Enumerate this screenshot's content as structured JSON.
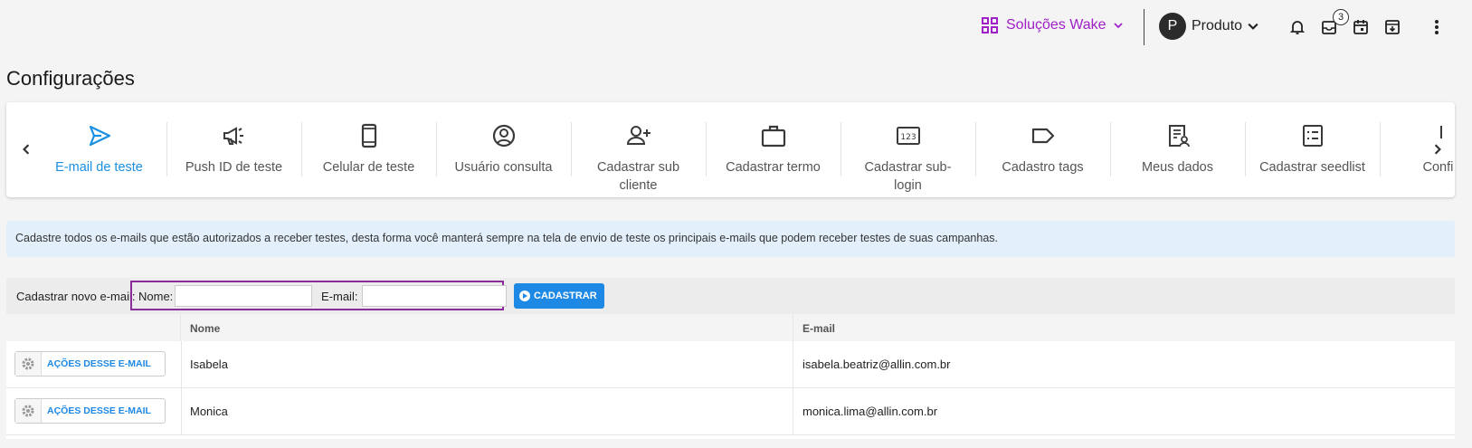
{
  "header": {
    "solutions_label": "Soluções Wake",
    "account_initial": "P",
    "account_label": "Produto",
    "notifications_badge": "3"
  },
  "page_title": "Configurações",
  "tabs": [
    {
      "label": "E-mail de teste",
      "icon": "send-icon",
      "active": true
    },
    {
      "label": "Push ID de teste",
      "icon": "megaphone-icon"
    },
    {
      "label": "Celular de teste",
      "icon": "phone-icon"
    },
    {
      "label": "Usuário consulta",
      "icon": "user-circle-icon"
    },
    {
      "label": "Cadastrar sub cliente",
      "icon": "user-add-icon"
    },
    {
      "label": "Cadastrar termo",
      "icon": "briefcase-icon"
    },
    {
      "label": "Cadastrar sub-login",
      "icon": "numbers-icon"
    },
    {
      "label": "Cadastro tags",
      "icon": "tag-icon"
    },
    {
      "label": "Meus dados",
      "icon": "profile-doc-icon"
    },
    {
      "label": "Cadastrar seedlist",
      "icon": "list-icon"
    },
    {
      "label": "Confi pu",
      "icon": "partial-icon"
    }
  ],
  "info_text": "Cadastre todos os e-mails que estão autorizados a receber testes, desta forma você manterá sempre na tela de envio de teste os principais e-mails que podem receber testes de suas campanhas.",
  "form": {
    "new_label": "Cadastrar novo e-mail:",
    "nome_label": "Nome:",
    "email_label": "E-mail:",
    "nome_value": "",
    "email_value": "",
    "submit_label": "CADASTRAR"
  },
  "table": {
    "columns": [
      "",
      "Nome",
      "E-mail"
    ],
    "action_label": "AÇÕES DESSE E-MAIL",
    "rows": [
      {
        "nome": "Isabela",
        "email": "isabela.beatriz@allin.com.br"
      },
      {
        "nome": "Monica",
        "email": "monica.lima@allin.com.br"
      }
    ]
  },
  "colors": {
    "accent": "#1e88e5",
    "solutions": "#a020c8",
    "highlight": "#8a2c9a",
    "info_bg": "#e3f0fc"
  }
}
